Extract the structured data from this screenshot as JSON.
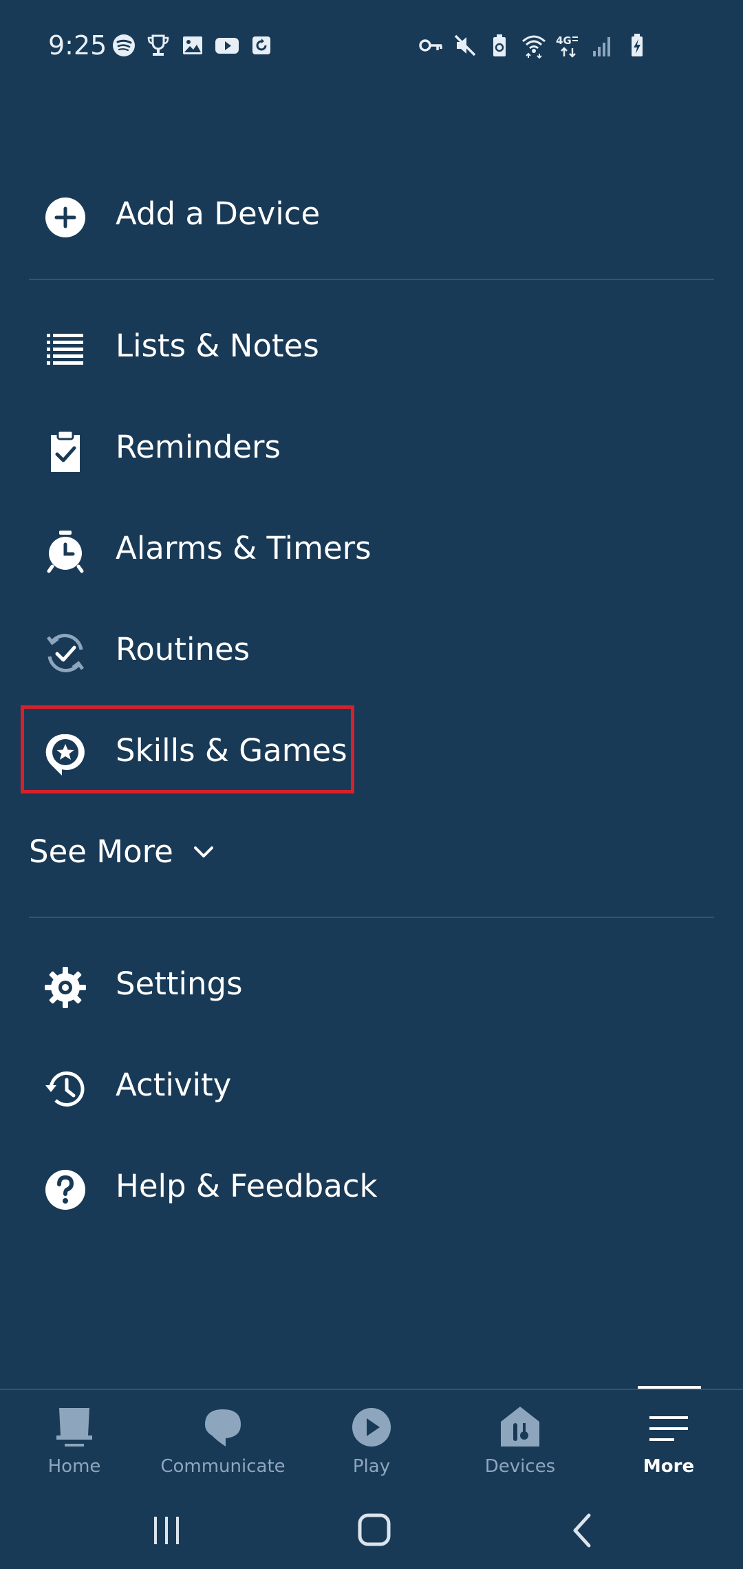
{
  "status_bar": {
    "time": "9:25",
    "left_icons": [
      "spotify-icon",
      "trophy-icon",
      "image-icon",
      "youtube-icon",
      "app-notification-icon"
    ],
    "right_icons": [
      "vpn-key-icon",
      "mute-icon",
      "battery-saver-icon",
      "wifi-icon",
      "4g-lte-icon",
      "signal-icon",
      "battery-charging-icon"
    ]
  },
  "menu": {
    "add_device": {
      "label": "Add a Device",
      "icon": "plus-circle-icon"
    },
    "items": [
      {
        "label": "Lists & Notes",
        "icon": "list-icon"
      },
      {
        "label": "Reminders",
        "icon": "clipboard-check-icon"
      },
      {
        "label": "Alarms & Timers",
        "icon": "alarm-clock-icon"
      },
      {
        "label": "Routines",
        "icon": "routines-icon"
      },
      {
        "label": "Skills & Games",
        "icon": "skills-star-icon",
        "highlighted": true
      }
    ],
    "see_more": {
      "label": "See More",
      "icon": "chevron-down-icon"
    },
    "footer_items": [
      {
        "label": "Settings",
        "icon": "gear-icon"
      },
      {
        "label": "Activity",
        "icon": "history-icon"
      },
      {
        "label": "Help & Feedback",
        "icon": "help-icon"
      }
    ]
  },
  "highlight_color": "#d6212b",
  "background_color": "#193a56",
  "bottom_nav": {
    "items": [
      {
        "label": "Home",
        "icon": "home-icon",
        "active": false
      },
      {
        "label": "Communicate",
        "icon": "chat-bubble-icon",
        "active": false
      },
      {
        "label": "Play",
        "icon": "play-icon",
        "active": false
      },
      {
        "label": "Devices",
        "icon": "devices-icon",
        "active": false
      },
      {
        "label": "More",
        "icon": "hamburger-menu-icon",
        "active": true
      }
    ]
  },
  "system_nav": {
    "buttons": [
      "recent-apps-icon",
      "home-button-icon",
      "back-icon"
    ]
  }
}
